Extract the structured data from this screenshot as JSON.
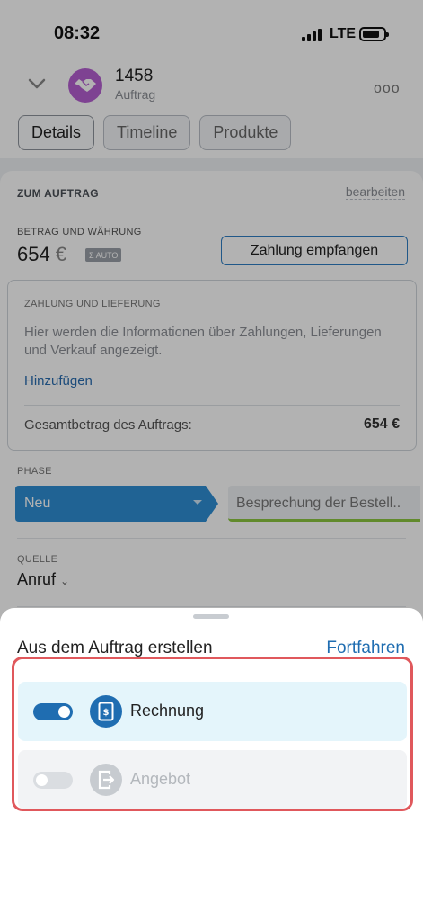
{
  "status_bar": {
    "time": "08:32",
    "network": "LTE"
  },
  "header": {
    "deal_number": "1458",
    "deal_type": "Auftrag",
    "more_icon": "ellipsis-icon",
    "collapse_icon": "chevron-down-icon",
    "avatar_icon": "handshake-icon",
    "avatar_color": "#b55fd1"
  },
  "tabs": [
    {
      "label": "Details",
      "active": true
    },
    {
      "label": "Timeline",
      "active": false
    },
    {
      "label": "Produkte",
      "active": false
    }
  ],
  "order": {
    "section_title": "ZUM AUFTRAG",
    "edit_label": "bearbeiten",
    "amount_label": "BETRAG UND WÄHRUNG",
    "amount_value": "654",
    "currency": "€",
    "auto_badge": "AUTO",
    "pay_button": "Zahlung empfangen",
    "payment_box": {
      "title": "ZAHLUNG UND LIEFERUNG",
      "text": "Hier werden die Informationen über Zahlungen, Lieferungen und Verkauf angezeigt.",
      "add_link": "Hinzufügen",
      "total_label": "Gesamtbetrag des Auftrags:",
      "total_value": "654 €"
    },
    "phase_label": "PHASE",
    "phase_current": "Neu",
    "phase_next": "Besprechung der Bestell..",
    "phase_color": "#2f8fd4",
    "phase_next_accent": "#8cc63f",
    "source_label": "QUELLE",
    "source_value": "Anruf"
  },
  "sheet": {
    "title": "Aus dem Auftrag erstellen",
    "continue_label": "Fortfahren",
    "options": [
      {
        "label": "Rechnung",
        "enabled": true,
        "icon": "invoice-icon"
      },
      {
        "label": "Angebot",
        "enabled": false,
        "icon": "quote-icon"
      }
    ],
    "accent_color": "#1f6db1",
    "highlight_color": "#e0585c"
  }
}
